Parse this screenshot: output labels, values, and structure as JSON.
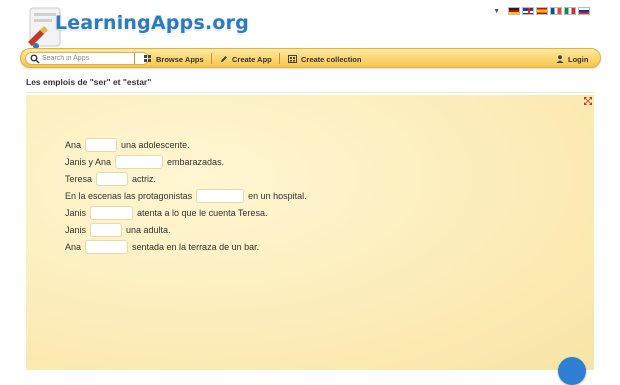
{
  "header": {
    "logo_text": "LearningApps.org"
  },
  "languages": [
    "de",
    "en",
    "es",
    "fr",
    "it",
    "ru"
  ],
  "search": {
    "placeholder": "Search in Apps"
  },
  "nav": {
    "browse_apps": "Browse Apps",
    "create_app": "Create App",
    "create_collection": "Create collection",
    "login": "Login"
  },
  "exercise": {
    "title": "Les emplois de \"ser\" et \"estar\"",
    "sentences": [
      {
        "before": "Ana",
        "after": "una adolescente.",
        "value": ""
      },
      {
        "before": "Janis y Ana",
        "after": "embarazadas.",
        "value": ""
      },
      {
        "before": "Teresa",
        "after": "actriz.",
        "value": ""
      },
      {
        "before": "En la escenas las protagonistas",
        "after": "en un hospital.",
        "value": ""
      },
      {
        "before": "Janis",
        "after": "atenta a lo que le cuenta Teresa.",
        "value": ""
      },
      {
        "before": "Janis",
        "after": "una adulta.",
        "value": ""
      },
      {
        "before": "Ana",
        "after": "sentada en la terraza de un bar.",
        "value": ""
      }
    ]
  },
  "colors": {
    "brand_blue": "#2a7cc2",
    "nav_yellow": "#f6c54a",
    "canvas_bg": "#fcedba"
  }
}
